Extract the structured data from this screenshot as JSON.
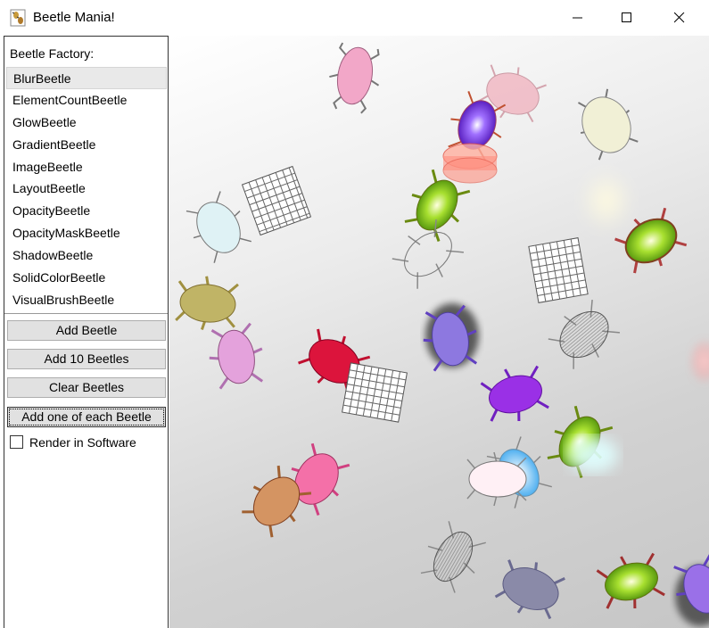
{
  "window": {
    "title": "Beetle Mania!"
  },
  "sidebar": {
    "factory_label": "Beetle Factory:",
    "items": [
      {
        "label": "BlurBeetle",
        "selected": true
      },
      {
        "label": "ElementCountBeetle"
      },
      {
        "label": "GlowBeetle"
      },
      {
        "label": "GradientBeetle"
      },
      {
        "label": "ImageBeetle"
      },
      {
        "label": "LayoutBeetle"
      },
      {
        "label": "OpacityBeetle"
      },
      {
        "label": "OpacityMaskBeetle"
      },
      {
        "label": "ShadowBeetle"
      },
      {
        "label": "SolidColorBeetle"
      },
      {
        "label": "VisualBrushBeetle"
      }
    ],
    "buttons": {
      "add": "Add Beetle",
      "add10": "Add 10 Beetles",
      "clear": "Clear Beetles",
      "add_each": "Add one of each Beetle"
    },
    "render_software": {
      "label": "Render in Software",
      "checked": false
    }
  },
  "colors": {
    "pink": "#f2a7c8",
    "purple": "#8a3fe0",
    "salmon": "#f08080",
    "cream": "#f1f0d6",
    "lime": "#b8d638",
    "lightblue": "#dff2f5",
    "olive": "#c0b466",
    "orchid": "#e4a2dc",
    "crimson": "#dc143c",
    "medpurple": "#8d78e0",
    "violet": "#9a30e6",
    "hotpink": "#f470a8",
    "peru": "#d49462",
    "slate": "#8a8aa8"
  }
}
